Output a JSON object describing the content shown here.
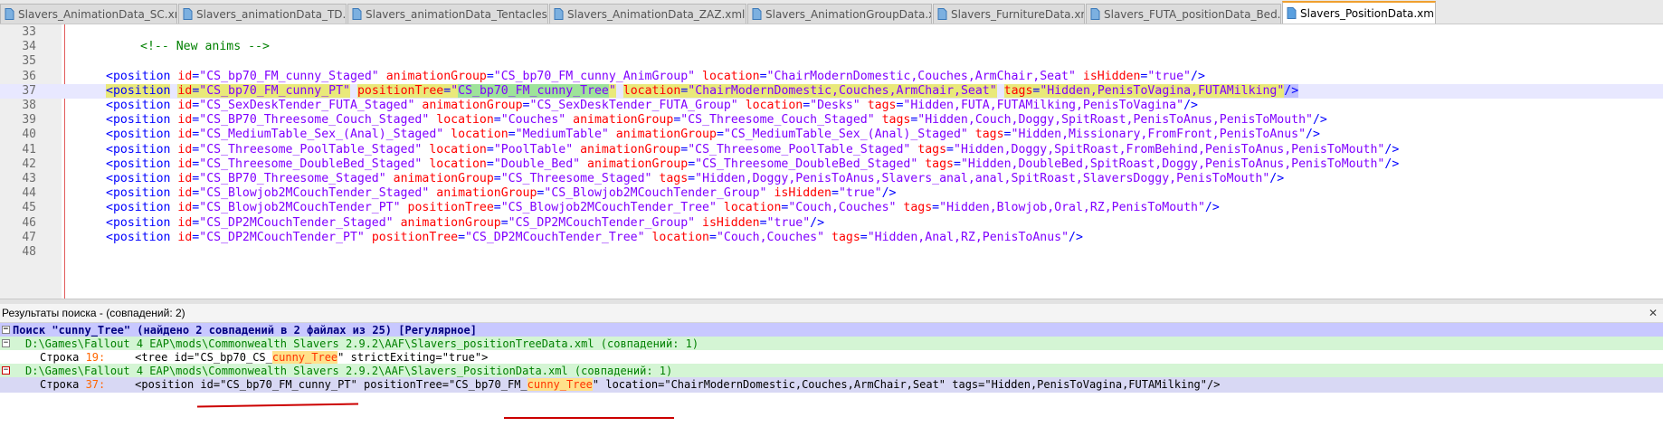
{
  "tabs": [
    {
      "label": "Slavers_AnimationData_SC.xml",
      "active": false
    },
    {
      "label": "Slavers_animationData_TD.xml",
      "active": false
    },
    {
      "label": "Slavers_animationData_Tentacles.xml",
      "active": false
    },
    {
      "label": "Slavers_AnimationData_ZAZ.xml",
      "active": false
    },
    {
      "label": "Slavers_AnimationGroupData.xml",
      "active": false
    },
    {
      "label": "Slavers_FurnitureData.xml",
      "active": false
    },
    {
      "label": "Slavers_FUTA_positionData_Bed.xml",
      "active": false
    },
    {
      "label": "Slavers_PositionData.xml",
      "active": true
    }
  ],
  "tab_controls": {
    "pin": "☆",
    "close": "✕"
  },
  "editor": {
    "current_line": "37",
    "lines": [
      {
        "n": "33",
        "tokens": []
      },
      {
        "n": "34",
        "indent": 2,
        "tokens": [
          [
            "cmt",
            "<!-- New anims -->"
          ]
        ]
      },
      {
        "n": "35",
        "tokens": []
      },
      {
        "n": "36",
        "tokens": [
          [
            "tag",
            "<position "
          ],
          [
            "attr",
            "id"
          ],
          [
            "eq",
            "="
          ],
          [
            "val",
            "\"CS_bp70_FM_cunny_Staged\" "
          ],
          [
            "attr",
            "animationGroup"
          ],
          [
            "eq",
            "="
          ],
          [
            "val",
            "\"CS_bp70_FM_cunny_AnimGroup\" "
          ],
          [
            "attr",
            "location"
          ],
          [
            "eq",
            "="
          ],
          [
            "val",
            "\"ChairModernDomestic,Couches,ArmChair,Seat\" "
          ],
          [
            "attr",
            "isHidden"
          ],
          [
            "eq",
            "="
          ],
          [
            "val",
            "\"true\""
          ],
          [
            "tag",
            "/>"
          ]
        ]
      },
      {
        "n": "37",
        "tokens": [
          [
            "tag_hl",
            "<position"
          ],
          [
            "plain",
            " "
          ],
          [
            "attr_hl",
            "id"
          ],
          [
            "eq_hl",
            "="
          ],
          [
            "val_hl",
            "\"CS_bp70_FM_cunny_PT\""
          ],
          [
            "plain",
            " "
          ],
          [
            "attr_hl",
            "positionTree"
          ],
          [
            "eq_hl",
            "="
          ],
          [
            "val_hl",
            "\""
          ],
          [
            "val_green",
            "CS_bp70_FM_cunny_Tree"
          ],
          [
            "val_hl",
            "\""
          ],
          [
            "plain",
            " "
          ],
          [
            "attr_hl",
            "location"
          ],
          [
            "eq_hl",
            "="
          ],
          [
            "val_hl",
            "\"ChairModernDomestic,Couches,ArmChair,Seat\""
          ],
          [
            "plain",
            " "
          ],
          [
            "attr_hl",
            "tags"
          ],
          [
            "eq_hl",
            "="
          ],
          [
            "val_hl",
            "\"Hidden,PenisToVagina,FUTAMilking\""
          ],
          [
            "tag_sel",
            "/>"
          ]
        ]
      },
      {
        "n": "38",
        "tokens": [
          [
            "tag",
            "<position "
          ],
          [
            "attr",
            "id"
          ],
          [
            "eq",
            "="
          ],
          [
            "val",
            "\"CS_SexDeskTender_FUTA_Staged\" "
          ],
          [
            "attr",
            "animationGroup"
          ],
          [
            "eq",
            "="
          ],
          [
            "val",
            "\"CS_SexDeskTender_FUTA_Group\" "
          ],
          [
            "attr",
            "location"
          ],
          [
            "eq",
            "="
          ],
          [
            "val",
            "\"Desks\" "
          ],
          [
            "attr",
            "tags"
          ],
          [
            "eq",
            "="
          ],
          [
            "val",
            "\"Hidden,FUTA,FUTAMilking,PenisToVagina\""
          ],
          [
            "tag",
            "/>"
          ]
        ]
      },
      {
        "n": "39",
        "tokens": [
          [
            "tag",
            "<position "
          ],
          [
            "attr",
            "id"
          ],
          [
            "eq",
            "="
          ],
          [
            "val",
            "\"CS_BP70_Threesome_Couch_Staged\" "
          ],
          [
            "attr",
            "location"
          ],
          [
            "eq",
            "="
          ],
          [
            "val",
            "\"Couches\" "
          ],
          [
            "attr",
            "animationGroup"
          ],
          [
            "eq",
            "="
          ],
          [
            "val",
            "\"CS_Threesome_Couch_Staged\" "
          ],
          [
            "attr",
            "tags"
          ],
          [
            "eq",
            "="
          ],
          [
            "val",
            "\"Hidden,Couch,Doggy,SpitRoast,PenisToAnus,PenisToMouth\""
          ],
          [
            "tag",
            "/>"
          ]
        ]
      },
      {
        "n": "40",
        "tokens": [
          [
            "tag",
            "<position "
          ],
          [
            "attr",
            "id"
          ],
          [
            "eq",
            "="
          ],
          [
            "val",
            "\"CS_MediumTable_Sex_(Anal)_Staged\" "
          ],
          [
            "attr",
            "location"
          ],
          [
            "eq",
            "="
          ],
          [
            "val",
            "\"MediumTable\" "
          ],
          [
            "attr",
            "animationGroup"
          ],
          [
            "eq",
            "="
          ],
          [
            "val",
            "\"CS_MediumTable_Sex_(Anal)_Staged\" "
          ],
          [
            "attr",
            "tags"
          ],
          [
            "eq",
            "="
          ],
          [
            "val",
            "\"Hidden,Missionary,FromFront,PenisToAnus\""
          ],
          [
            "tag",
            "/>"
          ]
        ]
      },
      {
        "n": "41",
        "tokens": [
          [
            "tag",
            "<position "
          ],
          [
            "attr",
            "id"
          ],
          [
            "eq",
            "="
          ],
          [
            "val",
            "\"CS_Threesome_PoolTable_Staged\" "
          ],
          [
            "attr",
            "location"
          ],
          [
            "eq",
            "="
          ],
          [
            "val",
            "\"PoolTable\" "
          ],
          [
            "attr",
            "animationGroup"
          ],
          [
            "eq",
            "="
          ],
          [
            "val",
            "\"CS_Threesome_PoolTable_Staged\" "
          ],
          [
            "attr",
            "tags"
          ],
          [
            "eq",
            "="
          ],
          [
            "val",
            "\"Hidden,Doggy,SpitRoast,FromBehind,PenisToAnus,PenisToMouth\""
          ],
          [
            "tag",
            "/>"
          ]
        ]
      },
      {
        "n": "42",
        "tokens": [
          [
            "tag",
            "<position "
          ],
          [
            "attr",
            "id"
          ],
          [
            "eq",
            "="
          ],
          [
            "val",
            "\"CS_Threesome_DoubleBed_Staged\" "
          ],
          [
            "attr",
            "location"
          ],
          [
            "eq",
            "="
          ],
          [
            "val",
            "\"Double_Bed\" "
          ],
          [
            "attr",
            "animationGroup"
          ],
          [
            "eq",
            "="
          ],
          [
            "val",
            "\"CS_Threesome_DoubleBed_Staged\" "
          ],
          [
            "attr",
            "tags"
          ],
          [
            "eq",
            "="
          ],
          [
            "val",
            "\"Hidden,DoubleBed,SpitRoast,Doggy,PenisToAnus,PenisToMouth\""
          ],
          [
            "tag",
            "/>"
          ]
        ]
      },
      {
        "n": "43",
        "tokens": [
          [
            "tag",
            "<position "
          ],
          [
            "attr",
            "id"
          ],
          [
            "eq",
            "="
          ],
          [
            "val",
            "\"CS_BP70_Threesome_Staged\" "
          ],
          [
            "attr",
            "animationGroup"
          ],
          [
            "eq",
            "="
          ],
          [
            "val",
            "\"CS_Threesome_Staged\" "
          ],
          [
            "attr",
            "tags"
          ],
          [
            "eq",
            "="
          ],
          [
            "val",
            "\"Hidden,Doggy,PenisToAnus,Slavers_anal,anal,SpitRoast,SlaversDoggy,PenisToMouth\""
          ],
          [
            "tag",
            "/>"
          ]
        ]
      },
      {
        "n": "44",
        "tokens": [
          [
            "tag",
            "<position "
          ],
          [
            "attr",
            "id"
          ],
          [
            "eq",
            "="
          ],
          [
            "val",
            "\"CS_Blowjob2MCouchTender_Staged\" "
          ],
          [
            "attr",
            "animationGroup"
          ],
          [
            "eq",
            "="
          ],
          [
            "val",
            "\"CS_Blowjob2MCouchTender_Group\" "
          ],
          [
            "attr",
            "isHidden"
          ],
          [
            "eq",
            "="
          ],
          [
            "val",
            "\"true\""
          ],
          [
            "tag",
            "/>"
          ]
        ]
      },
      {
        "n": "45",
        "tokens": [
          [
            "tag",
            "<position "
          ],
          [
            "attr",
            "id"
          ],
          [
            "eq",
            "="
          ],
          [
            "val",
            "\"CS_Blowjob2MCouchTender_PT\" "
          ],
          [
            "attr",
            "positionTree"
          ],
          [
            "eq",
            "="
          ],
          [
            "val",
            "\"CS_Blowjob2MCouchTender_Tree\" "
          ],
          [
            "attr",
            "location"
          ],
          [
            "eq",
            "="
          ],
          [
            "val",
            "\"Couch,Couches\" "
          ],
          [
            "attr",
            "tags"
          ],
          [
            "eq",
            "="
          ],
          [
            "val",
            "\"Hidden,Blowjob,Oral,RZ,PenisToMouth\""
          ],
          [
            "tag",
            "/>"
          ]
        ]
      },
      {
        "n": "46",
        "tokens": [
          [
            "tag",
            "<position "
          ],
          [
            "attr",
            "id"
          ],
          [
            "eq",
            "="
          ],
          [
            "val",
            "\"CS_DP2MCouchTender_Staged\" "
          ],
          [
            "attr",
            "animationGroup"
          ],
          [
            "eq",
            "="
          ],
          [
            "val",
            "\"CS_DP2MCouchTender_Group\" "
          ],
          [
            "attr",
            "isHidden"
          ],
          [
            "eq",
            "="
          ],
          [
            "val",
            "\"true\""
          ],
          [
            "tag",
            "/>"
          ]
        ]
      },
      {
        "n": "47",
        "tokens": [
          [
            "tag",
            "<position "
          ],
          [
            "attr",
            "id"
          ],
          [
            "eq",
            "="
          ],
          [
            "val",
            "\"CS_DP2MCouchTender_PT\" "
          ],
          [
            "attr",
            "positionTree"
          ],
          [
            "eq",
            "="
          ],
          [
            "val",
            "\"CS_DP2MCouchTender_Tree\" "
          ],
          [
            "attr",
            "location"
          ],
          [
            "eq",
            "="
          ],
          [
            "val",
            "\"Couch,Couches\" "
          ],
          [
            "attr",
            "tags"
          ],
          [
            "eq",
            "="
          ],
          [
            "val",
            "\"Hidden,Anal,RZ,PenisToAnus\""
          ],
          [
            "tag",
            "/>"
          ]
        ]
      },
      {
        "n": "48",
        "tokens": []
      }
    ]
  },
  "results": {
    "title": "Результаты поиска - (совпадений: 2)",
    "close": "✕",
    "search_line": "Поиск \"cunny_Tree\" (найдено 2 совпадений в 2 файлах из 25) [Регулярное]",
    "files": [
      {
        "path": "D:\\Games\\Fallout 4 EAP\\mods\\Commonwealth Slavers 2.9.2\\AAF\\Slavers_positionTreeData.xml (совпадений: 1)",
        "hit": {
          "prefix": "Строка ",
          "line_no": "19:",
          "before": "    <tree id=\"CS_bp70_CS_",
          "match": "cunny_Tree",
          "after": "\" strictExiting=\"true\">"
        }
      },
      {
        "path": "D:\\Games\\Fallout 4 EAP\\mods\\Commonwealth Slavers 2.9.2\\AAF\\Slavers_PositionData.xml (совпадений: 1)",
        "hit": {
          "prefix": "Строка ",
          "line_no": "37:",
          "before": "    <position id=\"CS_bp70_FM_cunny_PT\" positionTree=\"CS_bp70_FM_",
          "match": "cunny_Tree",
          "after": "\" location=\"ChairModernDomestic,Couches,ArmChair,Seat\" tags=\"Hidden,PenisToVagina,FUTAMilking\"/>"
        }
      }
    ]
  }
}
